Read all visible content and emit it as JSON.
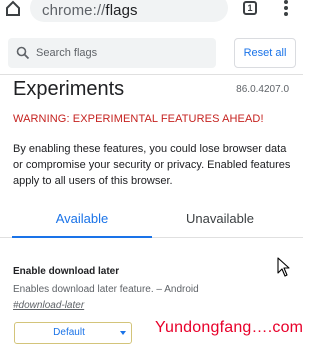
{
  "browser": {
    "url_prefix": "chrome://",
    "url_path": "flags",
    "tab_count": "1"
  },
  "search": {
    "placeholder": "Search flags",
    "reset_label": "Reset all"
  },
  "page": {
    "title": "Experiments",
    "version": "86.0.4207.0",
    "warning": "WARNING: EXPERIMENTAL FEATURES AHEAD!",
    "intro": "By enabling these features, you could lose browser data or compromise your security or privacy. Enabled features apply to all users of this browser."
  },
  "tabs": [
    {
      "label": "Available",
      "selected": true
    },
    {
      "label": "Unavailable",
      "selected": false
    }
  ],
  "experiment": {
    "name": "Enable download later",
    "description": "Enables download later feature. – Android",
    "link": "#download-later",
    "selected_option": "Default"
  },
  "watermark": "Yundongfang….com",
  "colors": {
    "accent": "#1a73e8",
    "warning": "#c5221f",
    "watermark": "#e8002a"
  },
  "icons": [
    "home-icon",
    "tab-switcher-icon",
    "overflow-menu-icon",
    "search-icon",
    "dropdown-caret-icon",
    "mouse-pointer-icon"
  ]
}
